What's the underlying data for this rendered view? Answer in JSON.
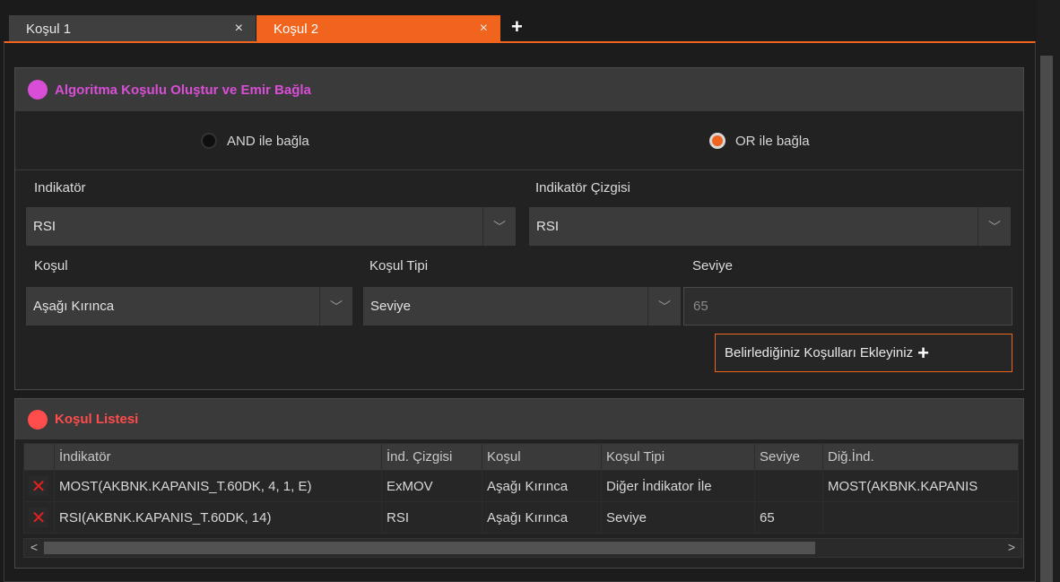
{
  "tabs": [
    {
      "label": "Koşul 1",
      "close": "×"
    },
    {
      "label": "Koşul 2",
      "close": "×"
    }
  ],
  "add_tab": "+",
  "algo_panel": {
    "title": "Algoritma Koşulu Oluştur ve Emir Bağla",
    "title_color": "#d84ed6",
    "radio_and": {
      "label": "AND ile bağla",
      "selected": false
    },
    "radio_or": {
      "label": "OR ile bağla",
      "selected": true
    },
    "indikator": {
      "label": "Indikatör",
      "value": "RSI"
    },
    "indikator_cizgisi": {
      "label": "Indikatör Çizgisi",
      "value": "RSI"
    },
    "kosul": {
      "label": "Koşul",
      "value": "Aşağı Kırınca"
    },
    "kosul_tipi": {
      "label": "Koşul Tipi",
      "value": "Seviye"
    },
    "seviye": {
      "label": "Seviye",
      "value": "65"
    },
    "add_button": {
      "label": "Belirlediğiniz Koşulları Ekleyiniz",
      "icon": "+"
    }
  },
  "list_panel": {
    "title": "Koşul Listesi",
    "title_color": "#ff4c4c",
    "columns": [
      "İndikatör",
      "İnd. Çizgisi",
      "Koşul",
      "Koşul Tipi",
      "Seviye",
      "Diğ.İnd."
    ],
    "rows": [
      {
        "delete": "✕",
        "indikator": "MOST(AKBNK.KAPANIS_T.60DK, 4, 1, E)",
        "ind_cizgisi": "ExMOV",
        "kosul": "Aşağı Kırınca",
        "kosul_tipi": "Diğer İndikator İle",
        "seviye": "",
        "dig_ind": "MOST(AKBNK.KAPANIS"
      },
      {
        "delete": "✕",
        "indikator": "RSI(AKBNK.KAPANIS_T.60DK, 14)",
        "ind_cizgisi": "RSI",
        "kosul": "Aşağı Kırınca",
        "kosul_tipi": "Seviye",
        "seviye": "65",
        "dig_ind": ""
      }
    ],
    "scroll_left": "<",
    "scroll_right": ">"
  },
  "colors": {
    "accent": "#f0641e",
    "panel_bg": "#222222",
    "header_bg": "#3a3a3a"
  }
}
